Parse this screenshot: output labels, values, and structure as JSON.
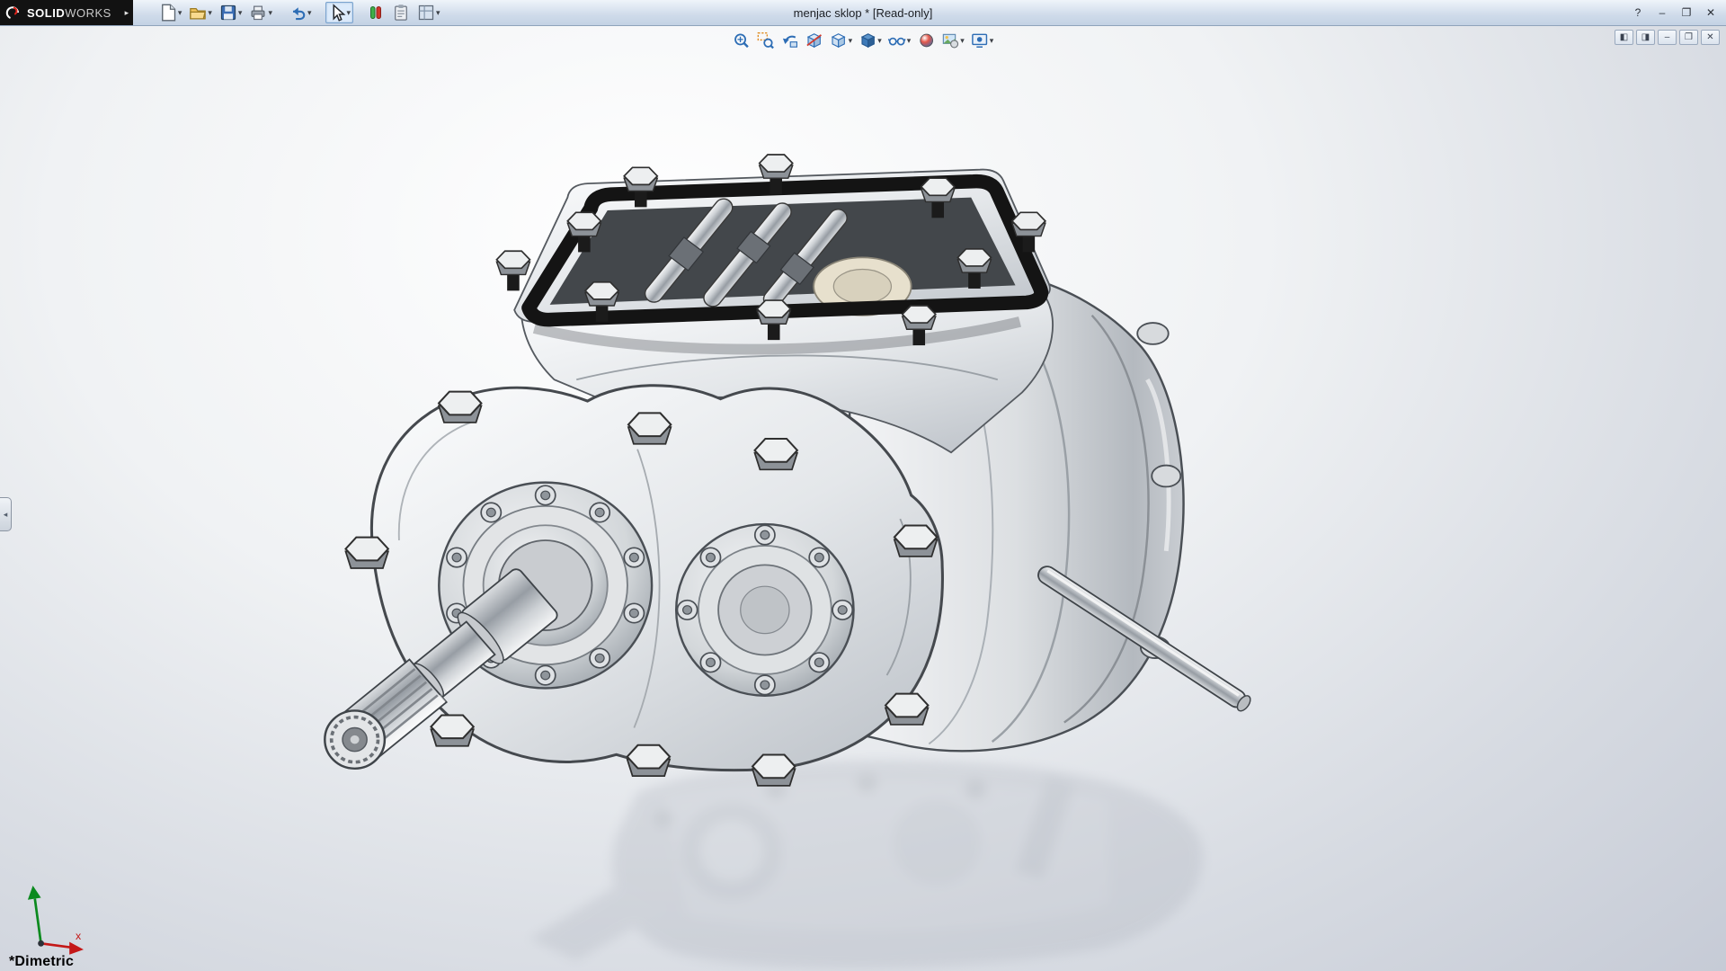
{
  "window": {
    "brand_solid": "SOLID",
    "brand_works": "WORKS",
    "title": "menjac sklop * [Read-only]",
    "controls": {
      "help": "?",
      "minimize": "–",
      "maximize": "❐",
      "close": "✕"
    }
  },
  "glyphs": {
    "caret": "▾",
    "flyout_arrow": "▸",
    "panel_arrow": "◂"
  },
  "main_toolbar": {
    "items": [
      {
        "name": "new-document",
        "has_dropdown": true
      },
      {
        "name": "open",
        "has_dropdown": true
      },
      {
        "name": "save",
        "has_dropdown": true
      },
      {
        "name": "print",
        "has_dropdown": true
      },
      {
        "name": "undo",
        "has_dropdown": true
      },
      {
        "name": "select",
        "has_dropdown": true,
        "active": true
      },
      {
        "name": "edit-color",
        "has_dropdown": false
      },
      {
        "name": "clipboard",
        "has_dropdown": false
      },
      {
        "name": "options",
        "has_dropdown": true
      }
    ]
  },
  "heads_up_toolbar": {
    "items": [
      {
        "name": "zoom-to-fit",
        "has_dropdown": false
      },
      {
        "name": "zoom-to-area",
        "has_dropdown": false
      },
      {
        "name": "previous-view",
        "has_dropdown": false
      },
      {
        "name": "section-view",
        "has_dropdown": false
      },
      {
        "name": "view-orientation",
        "has_dropdown": true
      },
      {
        "name": "display-style",
        "has_dropdown": true
      },
      {
        "name": "hide-show-items",
        "has_dropdown": true
      },
      {
        "name": "edit-appearance",
        "has_dropdown": false
      },
      {
        "name": "apply-scene",
        "has_dropdown": true
      },
      {
        "name": "view-settings",
        "has_dropdown": true
      }
    ]
  },
  "document_window": {
    "controls": {
      "pane_left": "◧",
      "pane_right": "◨",
      "minimize": "–",
      "restore": "❐",
      "close": "✕"
    }
  },
  "viewport": {
    "view_orientation_label": "*Dimetric",
    "triad": {
      "x_label": "x"
    }
  },
  "colors": {
    "brand_bar": "#121212",
    "brand_red": "#e2231a",
    "icon_blue": "#2d6db5",
    "canvas_top": "#ffffff",
    "canvas_bottom": "#c6cbd6",
    "gasket_black": "#141414"
  }
}
